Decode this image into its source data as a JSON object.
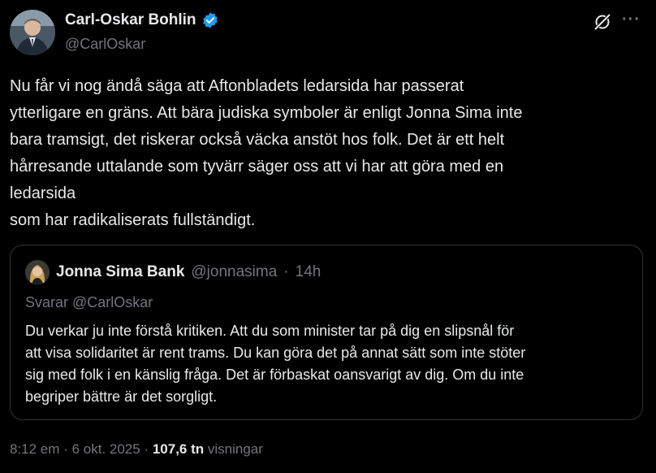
{
  "author": {
    "display_name": "Carl-Oskar Bohlin",
    "handle": "@CarlOskar",
    "verified_icon": "verified-badge-icon",
    "avatar_icon": "profile-avatar"
  },
  "actions": {
    "grok_icon": "grok-icon",
    "more_icon": "more-options-icon",
    "more_glyph": "···"
  },
  "tweet": {
    "lines": [
      "Nu får vi nog ändå säga att Aftonbladets ledarsida har passerat",
      "ytterligare en gräns. Att bära judiska symboler är enligt Jonna Sima inte",
      "bara tramsigt, det riskerar också väcka anstöt hos folk. Det är ett helt",
      "hårresande uttalande som tyvärr säger oss att vi har att göra med en",
      "ledarsida",
      "som har radikaliserats fullständigt."
    ]
  },
  "quote": {
    "display_name": "Jonna Sima Bank",
    "handle": "@jonnasima",
    "separator": "·",
    "time": "14h",
    "reply_to": "Svarar @CarlOskar",
    "lines": [
      "Du verkar ju inte förstå kritiken.  Att du som minister tar på dig en slipsnål för",
      "att visa solidaritet är rent trams. Du kan göra det på annat sätt som inte stöter",
      "sig med folk i en känslig fråga. Det är förbaskat oansvarigt av dig. Om du inte",
      "begriper bättre är det sorgligt."
    ]
  },
  "footer": {
    "time": "8:12 em",
    "sep1": "·",
    "date": "6 okt. 2025",
    "sep2": "·",
    "views_count": "107,6 tn",
    "views_label": "visningar"
  },
  "colors": {
    "background": "#000000",
    "text": "#e7e9ea",
    "muted": "#71767b",
    "border": "#2f3336",
    "verified": "#1d9bf0"
  }
}
